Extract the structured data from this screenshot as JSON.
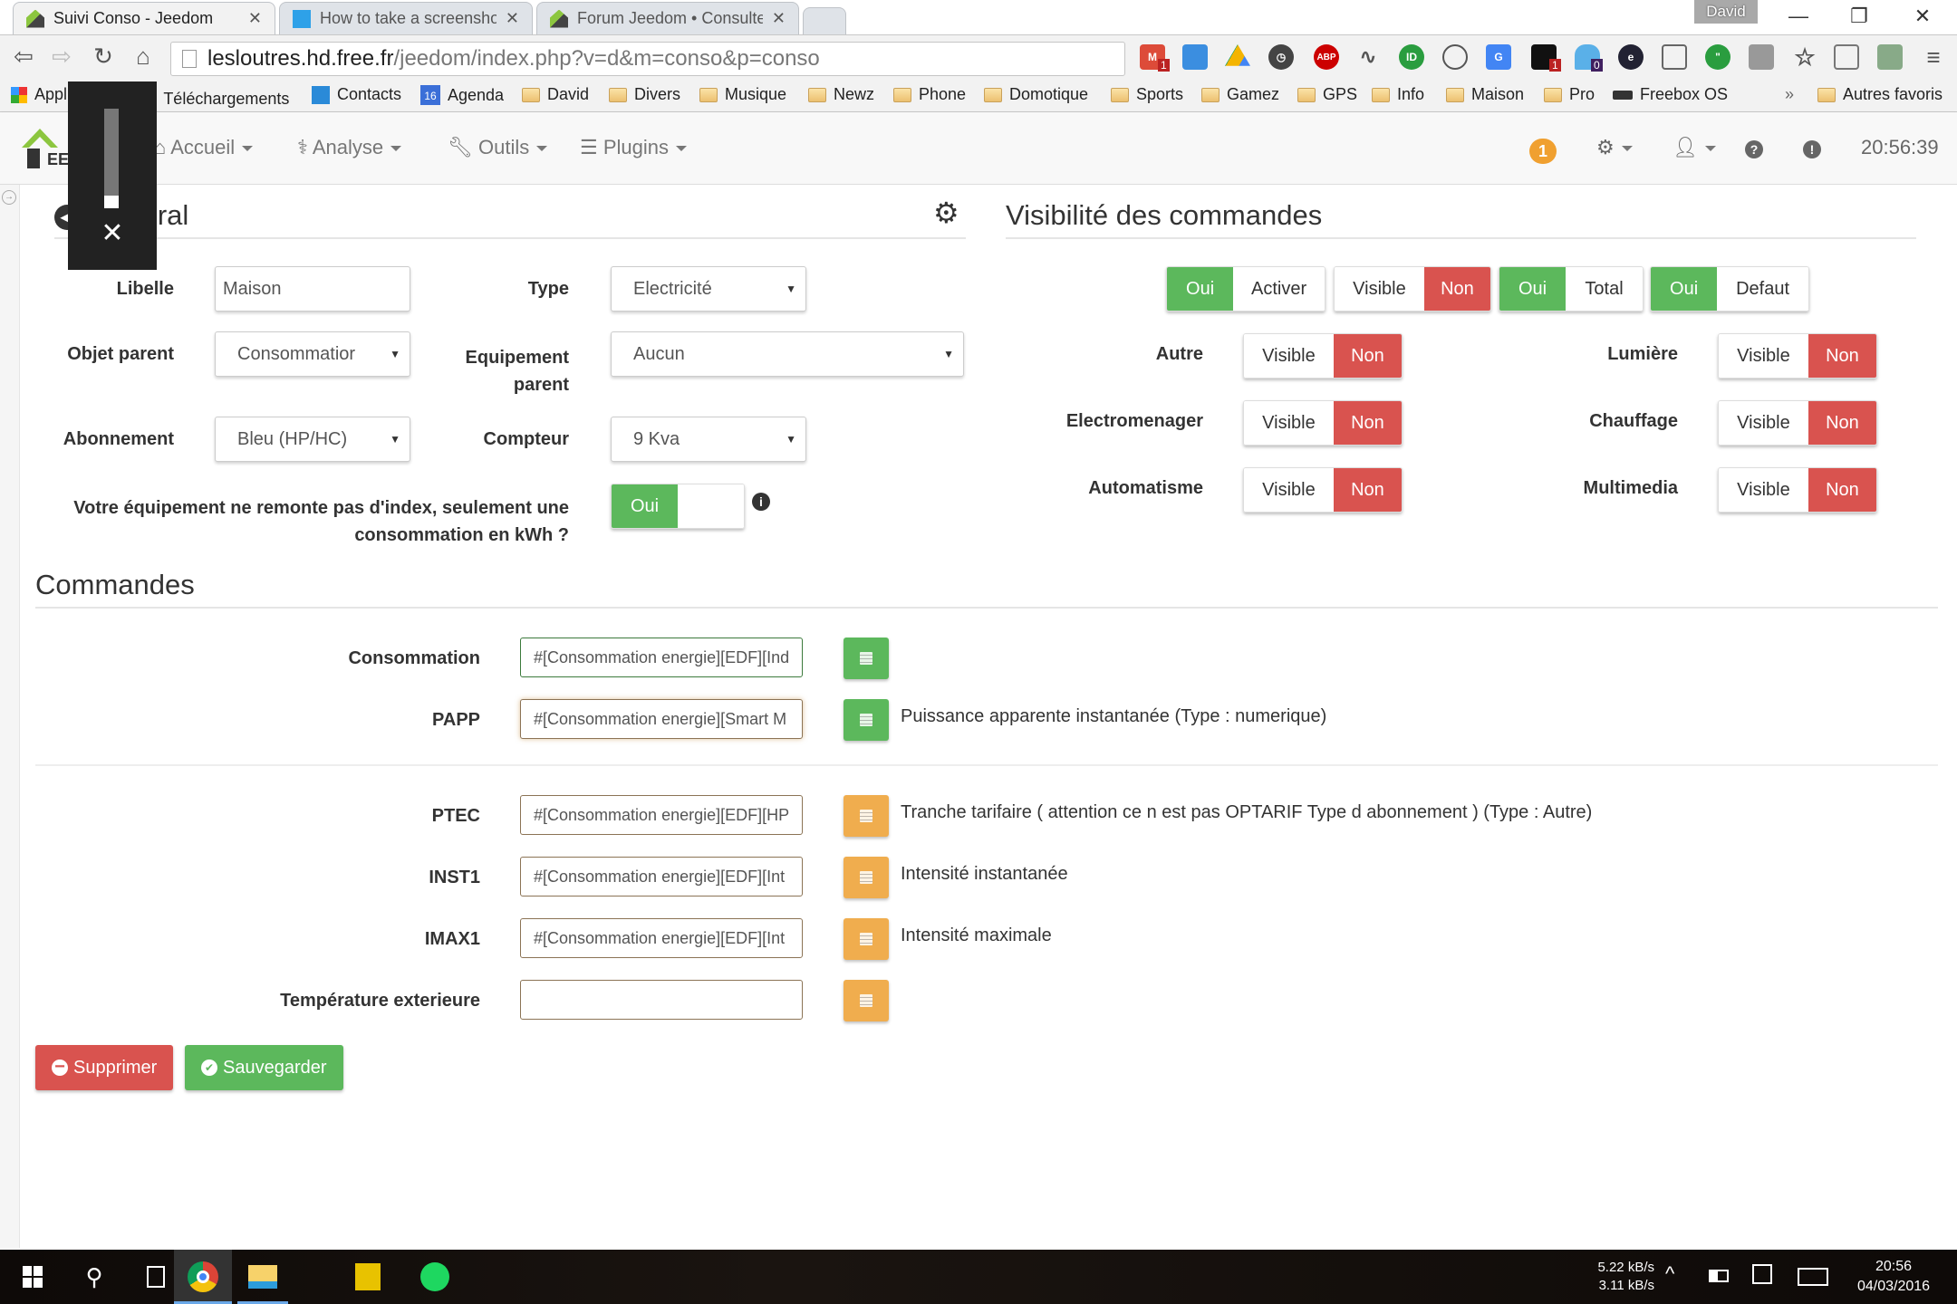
{
  "browser": {
    "tabs": [
      {
        "title": "Suivi Conso - Jeedom",
        "active": true
      },
      {
        "title": "How to take a screenshot",
        "active": false
      },
      {
        "title": "Forum Jeedom • Consulter",
        "active": false
      }
    ],
    "user": "David",
    "url_host": "lesloutres.hd.free.fr",
    "url_path": "/jeedom/index.php?v=d&m=conso&p=conso",
    "extension_badges": {
      "gmail": "1",
      "ext_dark": "1",
      "ghostery": "0"
    },
    "bookmarks": [
      "Applications",
      "Téléchargements",
      "Contacts",
      "Agenda",
      "David",
      "Divers",
      "Musique",
      "Newz",
      "Phone",
      "Domotique",
      "Sports",
      "Gamez",
      "GPS",
      "Info",
      "Maison",
      "Pro",
      "Freebox OS"
    ],
    "bookmarks_more": "»",
    "other_bookmarks": "Autres favoris",
    "agenda_day": "16"
  },
  "navbar": {
    "logo": "EEDOM",
    "menus": [
      "Accueil",
      "Analyse",
      "Outils",
      "Plugins"
    ],
    "notification_count": "1",
    "clock": "20:56:39"
  },
  "general": {
    "title": "Général",
    "fields": {
      "libelle": {
        "label": "Libelle",
        "value": "Maison"
      },
      "type": {
        "label": "Type",
        "value": "Electricité"
      },
      "objet_parent": {
        "label": "Objet parent",
        "value": "Consommatior"
      },
      "equipement_parent": {
        "label": "Equipement parent",
        "value": "Aucun"
      },
      "abonnement": {
        "label": "Abonnement",
        "value": "Bleu (HP/HC)"
      },
      "compteur": {
        "label": "Compteur",
        "value": "9 Kva"
      },
      "no_index": {
        "label": "Votre équipement ne remonte pas d'index, seulement une consommation en kWh ?",
        "value": "Oui"
      }
    }
  },
  "visibility": {
    "title": "Visibilité des commandes",
    "top_groups": [
      {
        "a": "Oui",
        "b": "Activer"
      },
      {
        "a": "Visible",
        "b": "Non"
      },
      {
        "a": "Oui",
        "b": "Total"
      },
      {
        "a": "Oui",
        "b": "Defaut"
      }
    ],
    "categories": [
      {
        "label": "Autre",
        "visible": "Visible",
        "state": "Non"
      },
      {
        "label": "Lumière",
        "visible": "Visible",
        "state": "Non"
      },
      {
        "label": "Electromenager",
        "visible": "Visible",
        "state": "Non"
      },
      {
        "label": "Chauffage",
        "visible": "Visible",
        "state": "Non"
      },
      {
        "label": "Automatisme",
        "visible": "Visible",
        "state": "Non"
      },
      {
        "label": "Multimedia",
        "visible": "Visible",
        "state": "Non"
      }
    ]
  },
  "commandes": {
    "title": "Commandes",
    "rows": [
      {
        "label": "Consommation",
        "value": "#[Consommation energie][EDF][Ind",
        "color": "green",
        "desc": ""
      },
      {
        "label": "PAPP",
        "value": "#[Consommation energie][Smart M",
        "color": "green",
        "desc": "Puissance apparente instantanée (Type : numerique)"
      },
      {
        "label": "PTEC",
        "value": "#[Consommation energie][EDF][HP",
        "color": "orange",
        "desc": "Tranche tarifaire ( attention ce n est pas OPTARIF Type d abonnement ) (Type : Autre)"
      },
      {
        "label": "INST1",
        "value": "#[Consommation energie][EDF][Int",
        "color": "orange",
        "desc": "Intensité instantanée"
      },
      {
        "label": "IMAX1",
        "value": "#[Consommation energie][EDF][Int",
        "color": "orange",
        "desc": "Intensité maximale"
      },
      {
        "label": "Température exterieure",
        "value": "",
        "color": "orange",
        "desc": ""
      }
    ]
  },
  "actions": {
    "delete": "Supprimer",
    "save": "Sauvegarder"
  },
  "colors": {
    "green": "#5cb85c",
    "red": "#d9534f",
    "orange": "#f0ad4e"
  },
  "taskbar": {
    "net_down": "5.22 kB/s",
    "net_up": "3.11 kB/s",
    "time": "20:56",
    "date": "04/03/2016"
  }
}
